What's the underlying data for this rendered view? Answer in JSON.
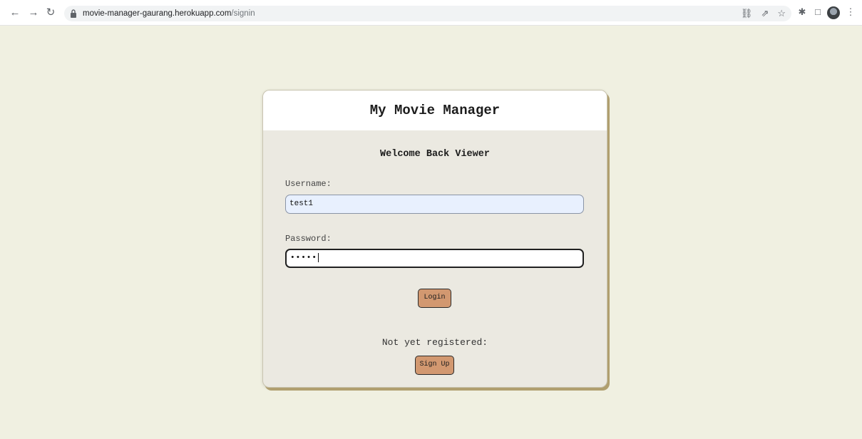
{
  "browser": {
    "url_host": "movie-manager-gaurang.herokuapp.com",
    "url_path": "/signin",
    "icons": [
      "back-icon",
      "forward-icon",
      "reload-icon",
      "lock-icon",
      "key-icon",
      "share-icon",
      "star-icon",
      "extensions-icon",
      "side-panel-icon",
      "profile-avatar",
      "menu-icon"
    ]
  },
  "card": {
    "title": "My Movie Manager",
    "welcome": "Welcome Back Viewer",
    "username_label": "Username:",
    "username_value": "test1",
    "password_label": "Password:",
    "password_value": "•••••",
    "login_label": "Login",
    "not_registered": "Not yet registered:",
    "signup_label": "Sign Up"
  },
  "colors": {
    "page_background": "#f0f0e1",
    "card_background": "#ebe9e1",
    "button_background": "#d29870",
    "username_autofill_background": "#e8f0fe"
  }
}
